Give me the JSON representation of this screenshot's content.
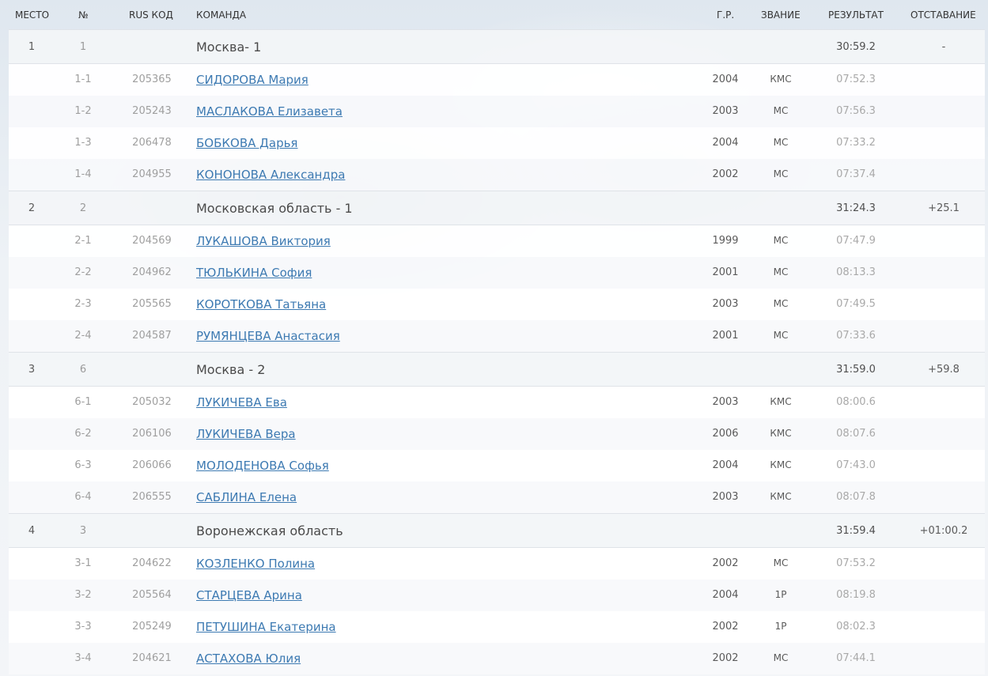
{
  "header": {
    "place": "МЕСТО",
    "num": "№",
    "code": "RUS КОД",
    "team": "КОМАНДА",
    "birth_year": "Г.Р.",
    "rank": "ЗВАНИЕ",
    "result": "РЕЗУЛЬТАТ",
    "gap": "ОТСТАВАНИЕ"
  },
  "teams": [
    {
      "place": "1",
      "num": "1",
      "name": "Москва- 1",
      "result": "30:59.2",
      "gap": "-",
      "athletes": [
        {
          "num": "1-1",
          "code": "205365",
          "name": "СИДОРОВА Мария",
          "year": "2004",
          "rank": "КМС",
          "result": "07:52.3"
        },
        {
          "num": "1-2",
          "code": "205243",
          "name": "МАСЛАКОВА Елизавета",
          "year": "2003",
          "rank": "МС",
          "result": "07:56.3"
        },
        {
          "num": "1-3",
          "code": "206478",
          "name": "БОБКОВА Дарья",
          "year": "2004",
          "rank": "МС",
          "result": "07:33.2"
        },
        {
          "num": "1-4",
          "code": "204955",
          "name": "КОНОНОВА Александра",
          "year": "2002",
          "rank": "МС",
          "result": "07:37.4"
        }
      ]
    },
    {
      "place": "2",
      "num": "2",
      "name": "Московская область - 1",
      "result": "31:24.3",
      "gap": "+25.1",
      "athletes": [
        {
          "num": "2-1",
          "code": "204569",
          "name": "ЛУКАШОВА Виктория",
          "year": "1999",
          "rank": "МС",
          "result": "07:47.9"
        },
        {
          "num": "2-2",
          "code": "204962",
          "name": "ТЮЛЬКИНА София",
          "year": "2001",
          "rank": "МС",
          "result": "08:13.3"
        },
        {
          "num": "2-3",
          "code": "205565",
          "name": "КОРОТКОВА Татьяна",
          "year": "2003",
          "rank": "МС",
          "result": "07:49.5"
        },
        {
          "num": "2-4",
          "code": "204587",
          "name": "РУМЯНЦЕВА Анастасия",
          "year": "2001",
          "rank": "МС",
          "result": "07:33.6"
        }
      ]
    },
    {
      "place": "3",
      "num": "6",
      "name": "Москва - 2",
      "result": "31:59.0",
      "gap": "+59.8",
      "athletes": [
        {
          "num": "6-1",
          "code": "205032",
          "name": "ЛУКИЧЕВА Ева",
          "year": "2003",
          "rank": "КМС",
          "result": "08:00.6"
        },
        {
          "num": "6-2",
          "code": "206106",
          "name": "ЛУКИЧЕВА Вера",
          "year": "2006",
          "rank": "КМС",
          "result": "08:07.6"
        },
        {
          "num": "6-3",
          "code": "206066",
          "name": "МОЛОДЕНОВА Софья",
          "year": "2004",
          "rank": "КМС",
          "result": "07:43.0"
        },
        {
          "num": "6-4",
          "code": "206555",
          "name": "САБЛИНА Елена",
          "year": "2003",
          "rank": "КМС",
          "result": "08:07.8"
        }
      ]
    },
    {
      "place": "4",
      "num": "3",
      "name": "Воронежская область",
      "result": "31:59.4",
      "gap": "+01:00.2",
      "athletes": [
        {
          "num": "3-1",
          "code": "204622",
          "name": "КОЗЛЕНКО Полина",
          "year": "2002",
          "rank": "МС",
          "result": "07:53.2"
        },
        {
          "num": "3-2",
          "code": "205564",
          "name": "СТАРЦЕВА Арина",
          "year": "2004",
          "rank": "1Р",
          "result": "08:19.8"
        },
        {
          "num": "3-3",
          "code": "205249",
          "name": "ПЕТУШИНА Екатерина",
          "year": "2002",
          "rank": "1Р",
          "result": "08:02.3"
        },
        {
          "num": "3-4",
          "code": "204621",
          "name": "АСТАХОВА Юлия",
          "year": "2002",
          "rank": "МС",
          "result": "07:44.1"
        }
      ]
    }
  ]
}
